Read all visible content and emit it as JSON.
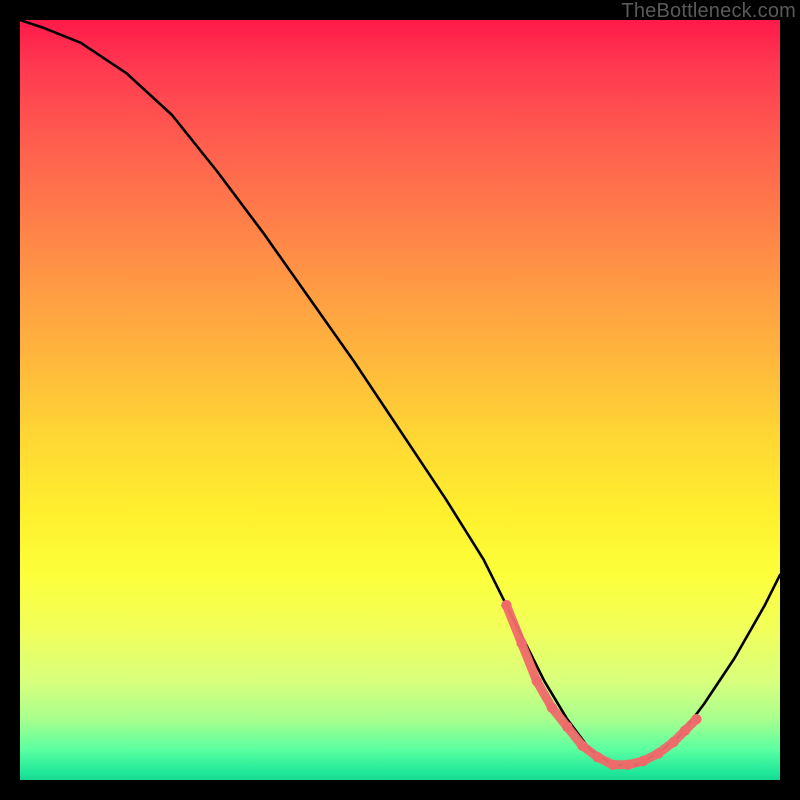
{
  "watermark": "TheBottleneck.com",
  "chart_data": {
    "type": "line",
    "title": "",
    "xlabel": "",
    "ylabel": "",
    "xlim": [
      0,
      100
    ],
    "ylim": [
      0,
      100
    ],
    "grid": false,
    "legend": false,
    "description": "Bottleneck percentage curve; high (red) region on left descending to a minimum (green) near x≈78 then rising again.",
    "series": [
      {
        "name": "bottleneck-curve",
        "color": "#000000",
        "x": [
          0,
          3,
          8,
          14,
          20,
          26,
          32,
          38,
          44,
          50,
          56,
          61,
          64,
          66,
          69,
          72,
          75,
          78,
          81,
          84,
          87,
          90,
          94,
          98,
          100
        ],
        "values": [
          100,
          99,
          97,
          93,
          87.5,
          80,
          72,
          63.5,
          55,
          46,
          37,
          29,
          23,
          19,
          13,
          8,
          4,
          2,
          2,
          3.5,
          6,
          10,
          16,
          23,
          27
        ]
      },
      {
        "name": "highlight-dots",
        "color": "#ef6a6a",
        "type": "scatter",
        "x": [
          64,
          66,
          68,
          70,
          72,
          74,
          76,
          78,
          80,
          82,
          84,
          86,
          87.5,
          89
        ],
        "values": [
          23,
          18,
          13,
          9.5,
          7,
          4.5,
          3,
          2,
          2,
          2.5,
          3.5,
          5,
          6.5,
          8
        ]
      }
    ]
  }
}
